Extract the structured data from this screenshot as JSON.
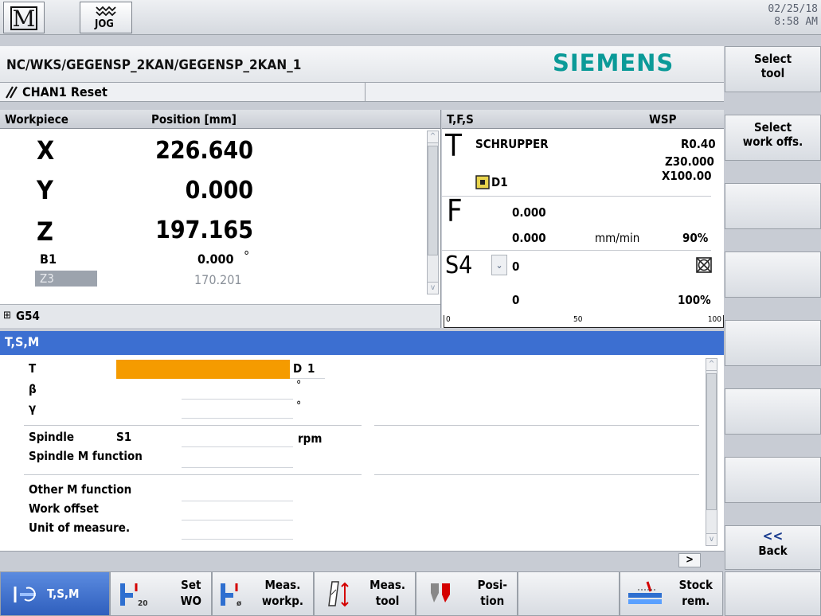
{
  "header": {
    "mode_icon": "machine-M-icon",
    "jog_label": "JOG",
    "date": "02/25/18",
    "time": "8:58 AM"
  },
  "path": {
    "program": "NC/WKS/GEGENSP_2KAN/GEGENSP_2KAN_1",
    "brand": "SIEMENS",
    "channel_status": "CHAN1 Reset"
  },
  "position_panel": {
    "col_workpiece": "Workpiece",
    "col_position": "Position [mm]",
    "axes": [
      {
        "name": "X",
        "value": "226.640"
      },
      {
        "name": "Y",
        "value": "0.000"
      },
      {
        "name": "Z",
        "value": "197.165"
      }
    ],
    "b1": {
      "name": "B1",
      "value": "0.000",
      "unit": "°"
    },
    "z3": {
      "name": "Z3",
      "value": "170.201"
    },
    "work_offset": "G54"
  },
  "tfs_panel": {
    "title": "T,F,S",
    "wsp": "WSP",
    "tool_name": "SCHRUPPER",
    "radius": "R0.40",
    "z_val": "Z30.000",
    "x_val": "X100.00",
    "d_num": "D1",
    "feed_set": "0.000",
    "feed_act": "0.000",
    "feed_unit": "mm/min",
    "feed_ovr": "90%",
    "spindle": "S4",
    "s_set": "0",
    "s_act": "0",
    "s_ovr": "100%",
    "scale_0": "0",
    "scale_50": "50",
    "scale_100": "100"
  },
  "tsm": {
    "title": "T,S,M",
    "t_label": "T",
    "d_label": "D",
    "d_value": "1",
    "beta_label": "β",
    "beta_unit": "°",
    "gamma_label": "γ",
    "gamma_unit": "°",
    "spindle_label": "Spindle",
    "spindle_sel": "S1",
    "spindle_unit": "rpm",
    "spindle_m_label": "Spindle M function",
    "other_m_label": "Other M function",
    "work_offset_label": "Work offset",
    "unit_label": "Unit of measure."
  },
  "vert_keys": [
    {
      "line1": "Select",
      "line2": "tool"
    },
    {
      "line1": "Select",
      "line2": "work offs."
    },
    {
      "line1": "",
      "line2": ""
    },
    {
      "line1": "",
      "line2": ""
    },
    {
      "line1": "",
      "line2": ""
    },
    {
      "line1": "",
      "line2": ""
    },
    {
      "line1": "",
      "line2": ""
    },
    {
      "line1": "<<",
      "line2": "Back"
    }
  ],
  "horiz_keys": [
    {
      "line1": "T,S,M",
      "line2": ""
    },
    {
      "line1": "Set",
      "line2": "WO"
    },
    {
      "line1": "Meas.",
      "line2": "workp."
    },
    {
      "line1": "Meas.",
      "line2": "tool"
    },
    {
      "line1": "Posi-",
      "line2": "tion"
    },
    {
      "line1": "",
      "line2": ""
    },
    {
      "line1": "Stock",
      "line2": "rem."
    },
    {
      "line1": "",
      "line2": ""
    }
  ],
  "colors": {
    "accent_blue": "#3c6fd1",
    "siemens_teal": "#0b9a98",
    "tool_field_orange": "#f59b00"
  }
}
